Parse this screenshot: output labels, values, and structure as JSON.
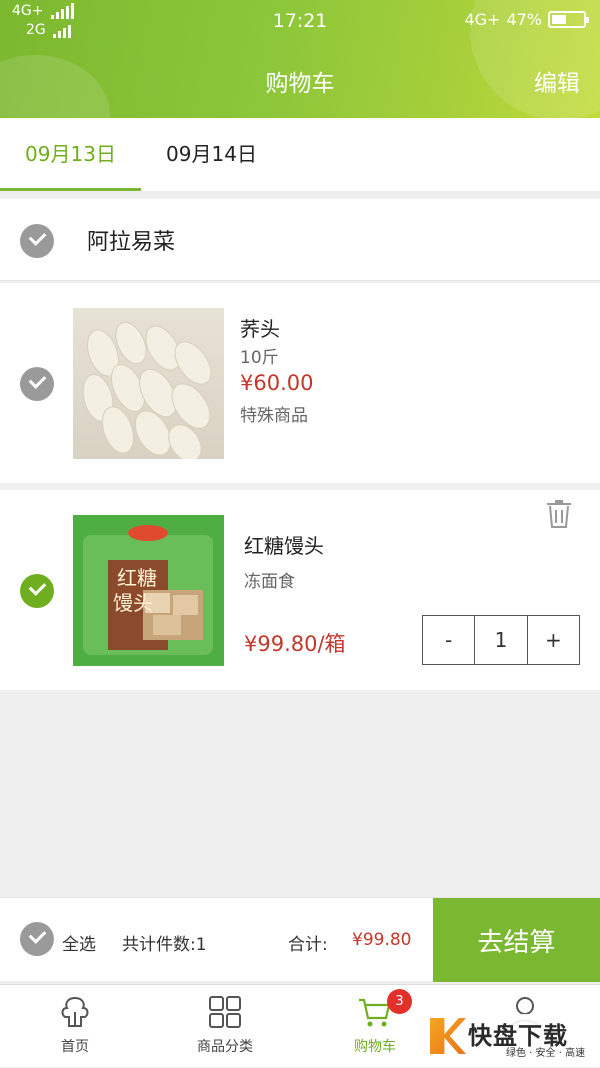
{
  "status_bar": {
    "signal_top": "4G+",
    "signal_bottom": "2G",
    "time": "17:21",
    "network": "4G+",
    "battery": "47%",
    "battery_level": 0.47
  },
  "header": {
    "title": "购物车",
    "edit_label": "编辑"
  },
  "date_tabs": [
    {
      "label": "09月13日",
      "active": true
    },
    {
      "label": "09月14日",
      "active": false
    }
  ],
  "store": {
    "name": "阿拉易菜",
    "checked": true
  },
  "items": [
    {
      "name": "荞头",
      "spec": "10斤",
      "price": "¥60.00",
      "tag": "特殊商品",
      "checked": true
    },
    {
      "name": "红糖馒头",
      "category": "冻面食",
      "price": "¥99.80/箱",
      "quantity": "1",
      "checked": true,
      "decrement": "-",
      "increment": "+"
    }
  ],
  "checkout": {
    "select_all": "全选",
    "count_text": "共计件数:1",
    "total_label": "合计:",
    "total_value": "¥99.80",
    "pay_button": "去结算"
  },
  "bottom_nav": [
    {
      "label": "首页",
      "icon": "home-icon"
    },
    {
      "label": "商品分类",
      "icon": "grid-icon"
    },
    {
      "label": "购物车",
      "icon": "cart-icon",
      "badge": "3",
      "active": true
    },
    {
      "label": "",
      "icon": "user-icon"
    }
  ],
  "watermark": {
    "title": "快盘下载",
    "subtitle": "绿色 · 安全 · 高速"
  },
  "colors": {
    "accent": "#7ab831",
    "price": "#c0392b",
    "badge": "#e4302b"
  }
}
